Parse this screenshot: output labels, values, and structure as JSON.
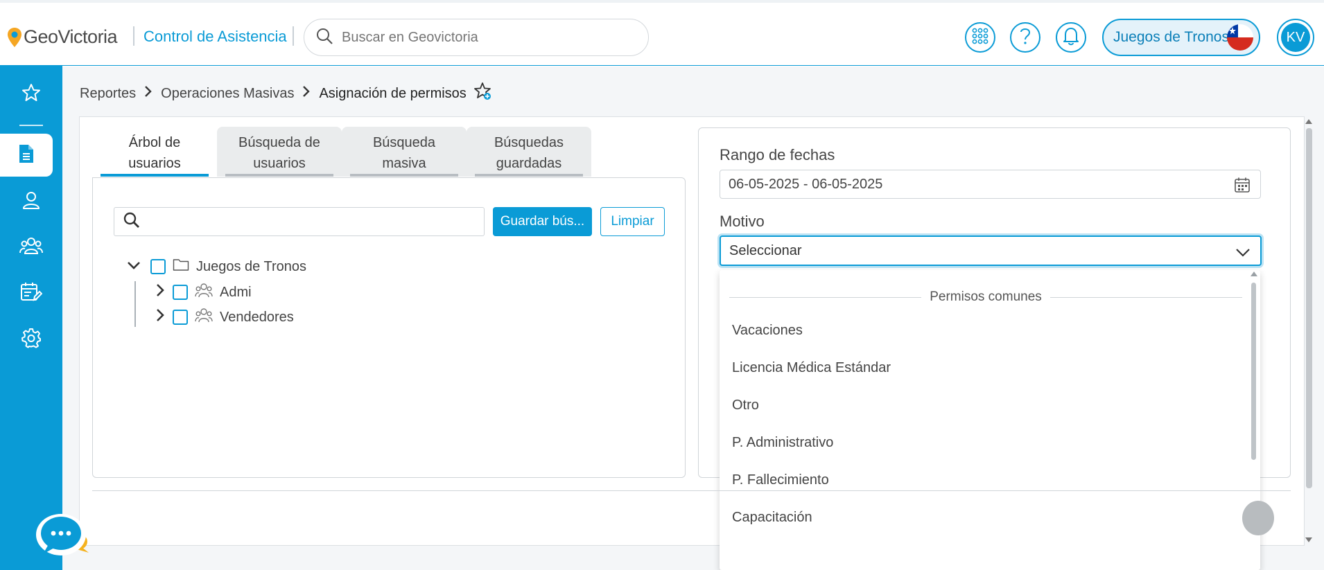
{
  "header": {
    "logo_text": "GeoVictoria",
    "product": "Control de Asistencia",
    "search_placeholder": "Buscar en Geovictoria",
    "company": "Juegos de Tronos",
    "avatar_initials": "KV",
    "icons": [
      "apps-grid-icon",
      "help-icon",
      "bell-icon",
      "chile-flag-icon"
    ]
  },
  "sidebar": {
    "items": [
      {
        "name": "favorites",
        "icon": "star-icon"
      },
      {
        "name": "reports",
        "icon": "document-icon",
        "active": true
      },
      {
        "name": "user",
        "icon": "user-icon"
      },
      {
        "name": "groups",
        "icon": "users-icon"
      },
      {
        "name": "calendar-edit",
        "icon": "calendar-edit-icon"
      },
      {
        "name": "settings",
        "icon": "gear-icon"
      }
    ]
  },
  "breadcrumb": {
    "items": [
      "Reportes",
      "Operaciones Masivas",
      "Asignación de permisos"
    ]
  },
  "tabs": [
    {
      "line1": "Árbol de",
      "line2": "usuarios",
      "active": true
    },
    {
      "line1": "Búsqueda de",
      "line2": "usuarios"
    },
    {
      "line1": "Búsqueda",
      "line2": "masiva"
    },
    {
      "line1": "Búsquedas",
      "line2": "guardadas"
    }
  ],
  "tree": {
    "search_value": "",
    "save_button": "Guardar bús...",
    "clear_button": "Limpiar",
    "root": "Juegos de Tronos",
    "children": [
      "Admi",
      "Vendedores"
    ]
  },
  "form": {
    "date_label": "Rango de fechas",
    "date_value": "06-05-2025 - 06-05-2025",
    "motivo_label": "Motivo",
    "motivo_value": "Seleccionar"
  },
  "dropdown": {
    "group": "Permisos comunes",
    "options": [
      "Vacaciones",
      "Licencia Médica Estándar",
      "Otro",
      "P. Administrativo",
      "P. Fallecimiento",
      "Capacitación"
    ]
  },
  "colors": {
    "primary": "#0a9bd6",
    "sidebar": "#0a9bd6",
    "page_bg": "#f4f6f8"
  }
}
